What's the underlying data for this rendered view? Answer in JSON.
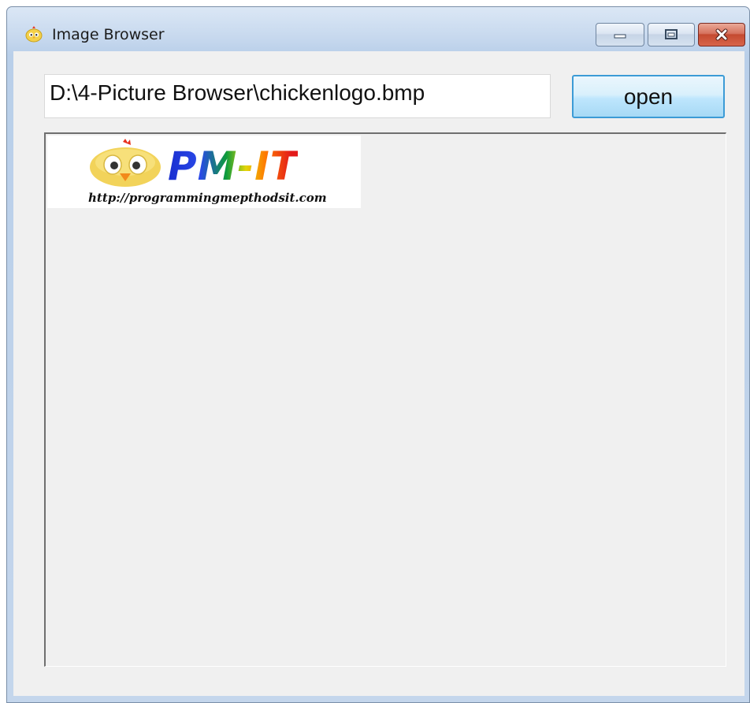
{
  "window": {
    "title": "Image Browser",
    "icon": "chick-icon",
    "controls": [
      "minimize-icon",
      "maximize-icon",
      "close-icon"
    ]
  },
  "toolbar": {
    "path_value": "D:\\4-Picture Browser\\chickenlogo.bmp",
    "open_label": "open"
  },
  "picture": {
    "brand_text": "PM-IT",
    "url_text": "http://programmingmepthodsit.com"
  },
  "colors": {
    "client_background": "#f0f0f0",
    "button_border": "#3c9bd6",
    "close_button": "#c44a30"
  }
}
